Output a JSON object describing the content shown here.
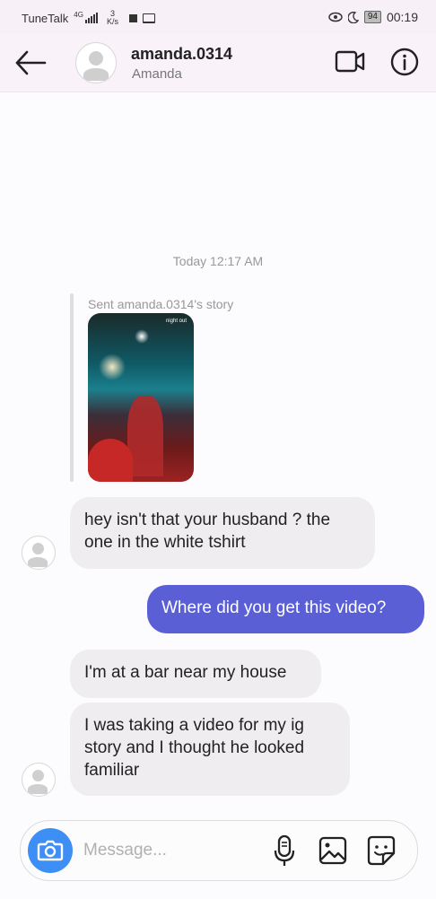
{
  "status_bar": {
    "carrier": "TuneTalk",
    "network": "4G",
    "speed_value": "3",
    "speed_unit": "K/s",
    "battery": "94",
    "time": "00:19"
  },
  "header": {
    "username": "amanda.0314",
    "full_name": "Amanda",
    "icons": [
      "back-arrow-icon",
      "avatar",
      "video-call-icon",
      "info-icon"
    ]
  },
  "conversation": {
    "timestamp": "Today 12:17 AM",
    "story_label": "Sent amanda.0314's story",
    "story_overlay_text": "night out",
    "messages": [
      {
        "sender": "them",
        "text": "hey isn't that your husband ? the one in the white tshirt"
      },
      {
        "sender": "me",
        "text": "Where did you get this video?"
      },
      {
        "sender": "them",
        "text": "I'm at a bar near my house"
      },
      {
        "sender": "them",
        "text": "I was taking a video for my ig story and I thought he looked familiar"
      }
    ]
  },
  "composer": {
    "placeholder": "Message...",
    "icons": [
      "camera-icon",
      "microphone-icon",
      "gallery-icon",
      "sticker-icon"
    ]
  },
  "colors": {
    "outgoing_bubble": "#5a5fd6",
    "incoming_bubble": "#efedf0",
    "camera_button": "#3d8ef5",
    "header_bg": "#f9f2f8"
  }
}
